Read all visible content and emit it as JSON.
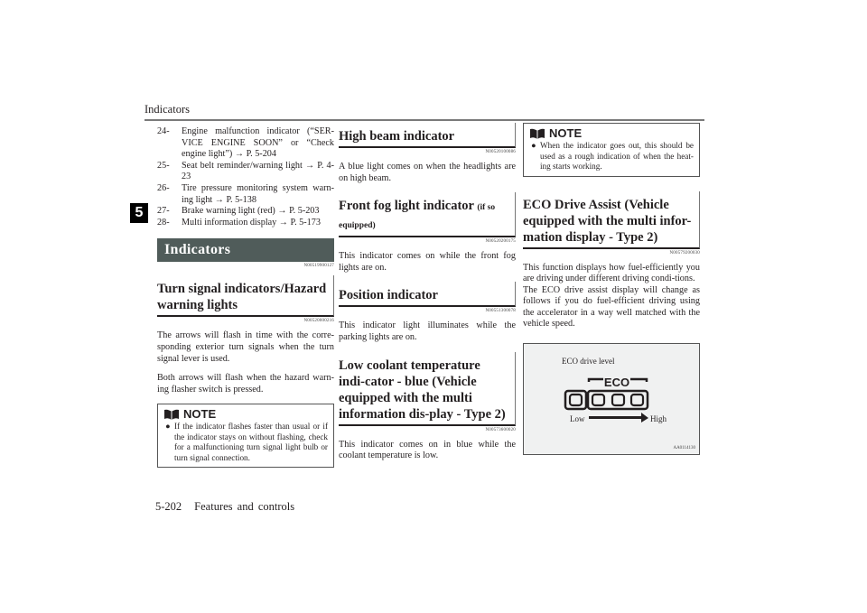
{
  "header": {
    "running_title": "Indicators",
    "chapter_tab": "5"
  },
  "column1": {
    "list_items": [
      {
        "num": "24-",
        "text": "Engine malfunction indicator (“SER-VICE ENGINE SOON” or “Check engine light”) → P. 5-204"
      },
      {
        "num": "25-",
        "text": "Seat belt reminder/warning light → P. 4-23"
      },
      {
        "num": "26-",
        "text": "Tire pressure monitoring system warn-ing light → P. 5-138"
      },
      {
        "num": "27-",
        "text": "Brake warning light (red) → P. 5-203"
      },
      {
        "num": "28-",
        "text": "Multi information display → P. 5-173"
      }
    ],
    "section_title": "Indicators",
    "section_code": "N00519900127",
    "turn_signal": {
      "heading": "Turn signal indicators/Hazard warning lights",
      "code": "N00520000216",
      "para1": "The arrows will flash in time with the corre-sponding exterior turn signals when the turn signal lever is used.",
      "para2": "Both arrows will flash when the hazard warn-ing flasher switch is pressed."
    },
    "note": {
      "title": "NOTE",
      "text": "If the indicator flashes faster than usual or if the indicator stays on without flashing, check for a malfunctioning turn signal light bulb or turn signal connection."
    }
  },
  "column2": {
    "high_beam": {
      "heading": "High beam indicator",
      "code": "N00520100086",
      "text": "A blue light comes on when the headlights are on high beam."
    },
    "front_fog": {
      "heading": "Front fog light indicator",
      "heading_suffix": "(if so equipped)",
      "code": "N00520200175",
      "text": "This indicator comes on while the front fog lights are on."
    },
    "position": {
      "heading": "Position indicator",
      "code": "N00551300078",
      "text": "This indicator light illuminates while the parking lights are on."
    },
    "low_coolant": {
      "heading": "Low coolant temperature indi-cator - blue (Vehicle equipped with the multi information dis-play - Type 2)",
      "code": "N00573600020",
      "text": "This indicator comes on in blue while the coolant temperature is low."
    }
  },
  "column3": {
    "note": {
      "title": "NOTE",
      "text": "When the indicator goes out, this should be used as a rough indication of when the heat-ing starts working."
    },
    "eco": {
      "heading": "ECO Drive Assist (Vehicle equipped with the multi infor-mation display - Type 2)",
      "code": "N00579200030",
      "para1": "This function displays how fuel-efficiently you are driving under different driving condi-tions.",
      "para2": "The ECO drive assist display will change as follows if you do fuel-efficient driving using the accelerator in a way well matched with the vehicle speed."
    },
    "figure": {
      "label": "ECO drive level",
      "eco_text": "ECO",
      "low": "Low",
      "high": "High",
      "code": "AA0114130"
    }
  },
  "footer": {
    "page_number": "5-202",
    "chapter_name": "Features and controls"
  }
}
